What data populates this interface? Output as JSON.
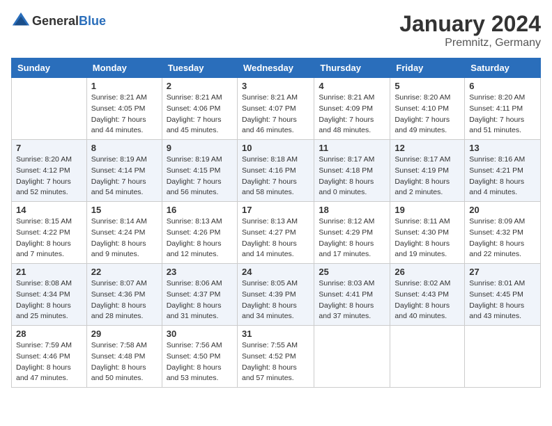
{
  "header": {
    "logo_general": "General",
    "logo_blue": "Blue",
    "title": "January 2024",
    "location": "Premnitz, Germany"
  },
  "days_of_week": [
    "Sunday",
    "Monday",
    "Tuesday",
    "Wednesday",
    "Thursday",
    "Friday",
    "Saturday"
  ],
  "weeks": [
    [
      {
        "day": "",
        "sunrise": "",
        "sunset": "",
        "daylight": ""
      },
      {
        "day": "1",
        "sunrise": "Sunrise: 8:21 AM",
        "sunset": "Sunset: 4:05 PM",
        "daylight": "Daylight: 7 hours and 44 minutes."
      },
      {
        "day": "2",
        "sunrise": "Sunrise: 8:21 AM",
        "sunset": "Sunset: 4:06 PM",
        "daylight": "Daylight: 7 hours and 45 minutes."
      },
      {
        "day": "3",
        "sunrise": "Sunrise: 8:21 AM",
        "sunset": "Sunset: 4:07 PM",
        "daylight": "Daylight: 7 hours and 46 minutes."
      },
      {
        "day": "4",
        "sunrise": "Sunrise: 8:21 AM",
        "sunset": "Sunset: 4:09 PM",
        "daylight": "Daylight: 7 hours and 48 minutes."
      },
      {
        "day": "5",
        "sunrise": "Sunrise: 8:20 AM",
        "sunset": "Sunset: 4:10 PM",
        "daylight": "Daylight: 7 hours and 49 minutes."
      },
      {
        "day": "6",
        "sunrise": "Sunrise: 8:20 AM",
        "sunset": "Sunset: 4:11 PM",
        "daylight": "Daylight: 7 hours and 51 minutes."
      }
    ],
    [
      {
        "day": "7",
        "sunrise": "Sunrise: 8:20 AM",
        "sunset": "Sunset: 4:12 PM",
        "daylight": "Daylight: 7 hours and 52 minutes."
      },
      {
        "day": "8",
        "sunrise": "Sunrise: 8:19 AM",
        "sunset": "Sunset: 4:14 PM",
        "daylight": "Daylight: 7 hours and 54 minutes."
      },
      {
        "day": "9",
        "sunrise": "Sunrise: 8:19 AM",
        "sunset": "Sunset: 4:15 PM",
        "daylight": "Daylight: 7 hours and 56 minutes."
      },
      {
        "day": "10",
        "sunrise": "Sunrise: 8:18 AM",
        "sunset": "Sunset: 4:16 PM",
        "daylight": "Daylight: 7 hours and 58 minutes."
      },
      {
        "day": "11",
        "sunrise": "Sunrise: 8:17 AM",
        "sunset": "Sunset: 4:18 PM",
        "daylight": "Daylight: 8 hours and 0 minutes."
      },
      {
        "day": "12",
        "sunrise": "Sunrise: 8:17 AM",
        "sunset": "Sunset: 4:19 PM",
        "daylight": "Daylight: 8 hours and 2 minutes."
      },
      {
        "day": "13",
        "sunrise": "Sunrise: 8:16 AM",
        "sunset": "Sunset: 4:21 PM",
        "daylight": "Daylight: 8 hours and 4 minutes."
      }
    ],
    [
      {
        "day": "14",
        "sunrise": "Sunrise: 8:15 AM",
        "sunset": "Sunset: 4:22 PM",
        "daylight": "Daylight: 8 hours and 7 minutes."
      },
      {
        "day": "15",
        "sunrise": "Sunrise: 8:14 AM",
        "sunset": "Sunset: 4:24 PM",
        "daylight": "Daylight: 8 hours and 9 minutes."
      },
      {
        "day": "16",
        "sunrise": "Sunrise: 8:13 AM",
        "sunset": "Sunset: 4:26 PM",
        "daylight": "Daylight: 8 hours and 12 minutes."
      },
      {
        "day": "17",
        "sunrise": "Sunrise: 8:13 AM",
        "sunset": "Sunset: 4:27 PM",
        "daylight": "Daylight: 8 hours and 14 minutes."
      },
      {
        "day": "18",
        "sunrise": "Sunrise: 8:12 AM",
        "sunset": "Sunset: 4:29 PM",
        "daylight": "Daylight: 8 hours and 17 minutes."
      },
      {
        "day": "19",
        "sunrise": "Sunrise: 8:11 AM",
        "sunset": "Sunset: 4:30 PM",
        "daylight": "Daylight: 8 hours and 19 minutes."
      },
      {
        "day": "20",
        "sunrise": "Sunrise: 8:09 AM",
        "sunset": "Sunset: 4:32 PM",
        "daylight": "Daylight: 8 hours and 22 minutes."
      }
    ],
    [
      {
        "day": "21",
        "sunrise": "Sunrise: 8:08 AM",
        "sunset": "Sunset: 4:34 PM",
        "daylight": "Daylight: 8 hours and 25 minutes."
      },
      {
        "day": "22",
        "sunrise": "Sunrise: 8:07 AM",
        "sunset": "Sunset: 4:36 PM",
        "daylight": "Daylight: 8 hours and 28 minutes."
      },
      {
        "day": "23",
        "sunrise": "Sunrise: 8:06 AM",
        "sunset": "Sunset: 4:37 PM",
        "daylight": "Daylight: 8 hours and 31 minutes."
      },
      {
        "day": "24",
        "sunrise": "Sunrise: 8:05 AM",
        "sunset": "Sunset: 4:39 PM",
        "daylight": "Daylight: 8 hours and 34 minutes."
      },
      {
        "day": "25",
        "sunrise": "Sunrise: 8:03 AM",
        "sunset": "Sunset: 4:41 PM",
        "daylight": "Daylight: 8 hours and 37 minutes."
      },
      {
        "day": "26",
        "sunrise": "Sunrise: 8:02 AM",
        "sunset": "Sunset: 4:43 PM",
        "daylight": "Daylight: 8 hours and 40 minutes."
      },
      {
        "day": "27",
        "sunrise": "Sunrise: 8:01 AM",
        "sunset": "Sunset: 4:45 PM",
        "daylight": "Daylight: 8 hours and 43 minutes."
      }
    ],
    [
      {
        "day": "28",
        "sunrise": "Sunrise: 7:59 AM",
        "sunset": "Sunset: 4:46 PM",
        "daylight": "Daylight: 8 hours and 47 minutes."
      },
      {
        "day": "29",
        "sunrise": "Sunrise: 7:58 AM",
        "sunset": "Sunset: 4:48 PM",
        "daylight": "Daylight: 8 hours and 50 minutes."
      },
      {
        "day": "30",
        "sunrise": "Sunrise: 7:56 AM",
        "sunset": "Sunset: 4:50 PM",
        "daylight": "Daylight: 8 hours and 53 minutes."
      },
      {
        "day": "31",
        "sunrise": "Sunrise: 7:55 AM",
        "sunset": "Sunset: 4:52 PM",
        "daylight": "Daylight: 8 hours and 57 minutes."
      },
      {
        "day": "",
        "sunrise": "",
        "sunset": "",
        "daylight": ""
      },
      {
        "day": "",
        "sunrise": "",
        "sunset": "",
        "daylight": ""
      },
      {
        "day": "",
        "sunrise": "",
        "sunset": "",
        "daylight": ""
      }
    ]
  ]
}
